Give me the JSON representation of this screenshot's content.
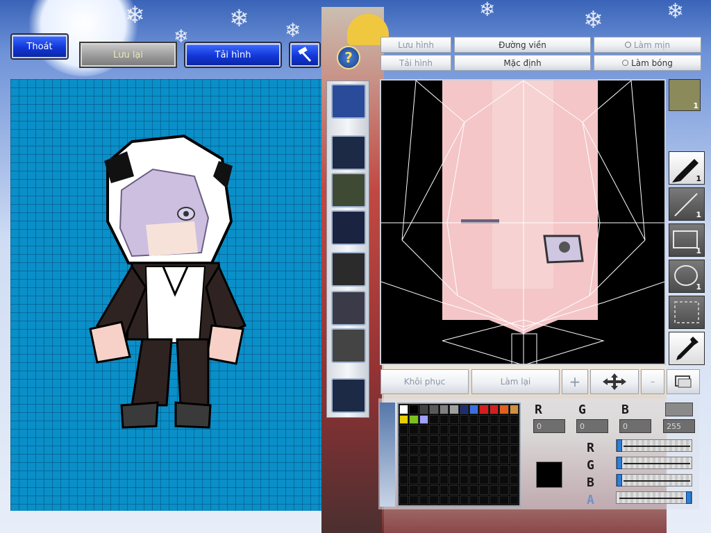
{
  "top_left_buttons": {
    "exit": "Thoát",
    "save": "Lưu lại",
    "reload": "Tải hình"
  },
  "editor_toolbar": {
    "save_image": "Lưu hình",
    "load_image": "Tải hình",
    "outline": "Đường viền",
    "default": "Mặc định",
    "smooth": "Làm mịn",
    "shade": "Làm bóng"
  },
  "bottom_buttons": {
    "restore": "Khôi phục",
    "redo": "Làm lại"
  },
  "tools": [
    {
      "name": "pen",
      "count": "1"
    },
    {
      "name": "line",
      "count": "1"
    },
    {
      "name": "rectangle",
      "count": "1"
    },
    {
      "name": "ellipse",
      "count": "1"
    },
    {
      "name": "select",
      "count": ""
    },
    {
      "name": "eyedropper",
      "count": ""
    }
  ],
  "face_icon_count": "1",
  "color": {
    "labels": {
      "r": "R",
      "g": "G",
      "b": "B",
      "a": "A"
    },
    "r": "0",
    "g": "0",
    "b": "0",
    "a": "255",
    "current": "#000000"
  },
  "palette_row1": [
    "#ffffff",
    "#000000",
    "#404040",
    "#595959",
    "#808080",
    "#a0a0a0",
    "#1e2f6e",
    "#3c6ee0",
    "#d41e1e",
    "#d02020",
    "#e06020",
    "#d09040"
  ],
  "palette_row2": [
    "#e8d000",
    "#7cc020",
    "#a0a0ff"
  ],
  "colors": {
    "preview_bg": "#0a8fc8",
    "accent_blue": "#1237d8"
  }
}
